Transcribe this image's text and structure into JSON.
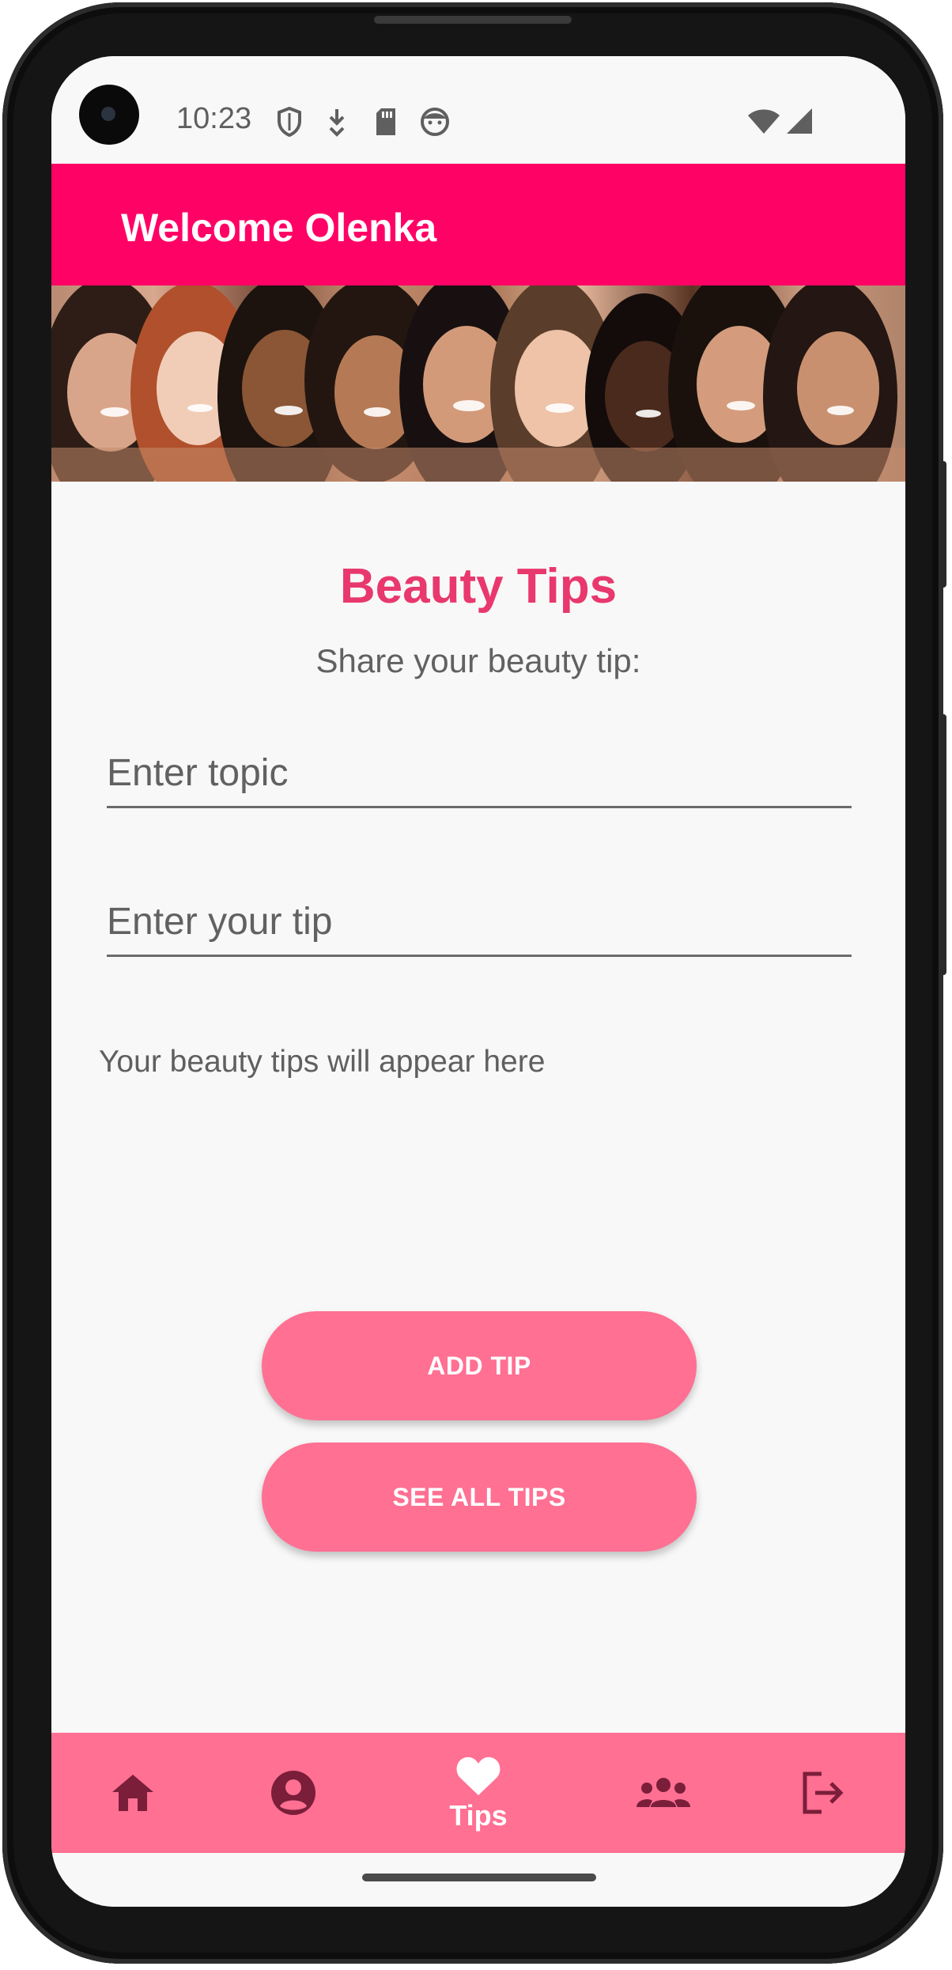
{
  "status_bar": {
    "time": "10:23",
    "icons": [
      "shield-icon",
      "download-icon",
      "sd-card-icon",
      "face-icon",
      "wifi-icon",
      "signal-icon"
    ]
  },
  "app_bar": {
    "title": "Welcome Olenka",
    "color": "#ff0266"
  },
  "banner": {
    "icon": "group-photo-banner"
  },
  "main": {
    "heading": "Beauty Tips",
    "subheading": "Share your beauty tip:",
    "topic_field": {
      "placeholder": "Enter topic",
      "value": ""
    },
    "tip_field": {
      "placeholder": "Enter your tip",
      "value": ""
    },
    "tips_placeholder": "Your beauty tips will appear here",
    "add_button_label": "ADD TIP",
    "see_all_button_label": "SEE ALL TIPS",
    "accent_color": "#e8386d",
    "button_color": "#ff7093"
  },
  "bottom_nav": {
    "items": [
      {
        "icon": "home-icon",
        "label": ""
      },
      {
        "icon": "account-icon",
        "label": ""
      },
      {
        "icon": "heart-icon",
        "label": "Tips",
        "selected": true
      },
      {
        "icon": "group-icon",
        "label": ""
      },
      {
        "icon": "logout-icon",
        "label": ""
      }
    ],
    "active_color": "#ffffff",
    "inactive_color": "#7a1e3a"
  }
}
